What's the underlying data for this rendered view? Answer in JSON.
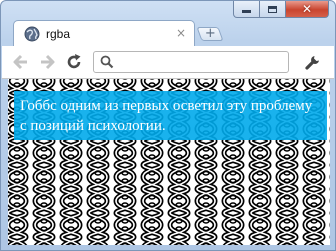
{
  "tab": {
    "title": "rgba",
    "close_glyph": "×"
  },
  "new_tab": {
    "glyph": "+"
  },
  "omnibox": {
    "value": "",
    "placeholder": ""
  },
  "window_controls": {
    "close_glyph": "✕"
  },
  "icons": [
    "globe-icon",
    "back-icon",
    "forward-icon",
    "reload-icon",
    "search-icon",
    "wrench-icon"
  ],
  "page": {
    "banner_text": "Гоббс одним из первых осветил эту проблему с позиций психологии.",
    "banner_color": "#00aaeb"
  }
}
